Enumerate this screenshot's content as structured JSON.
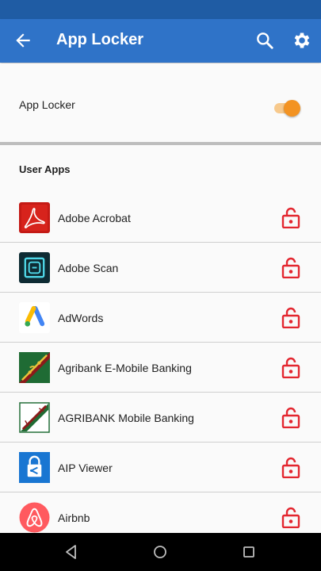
{
  "app_bar": {
    "title": "App Locker",
    "icons": [
      "back-arrow-icon",
      "search-icon",
      "gear-icon"
    ],
    "background": "#2f73c8"
  },
  "master_toggle": {
    "label": "App Locker",
    "enabled": true,
    "accent": "#f39322"
  },
  "section": {
    "title": "User Apps"
  },
  "apps": [
    {
      "name": "Adobe Acrobat",
      "icon": "adobe-acrobat-icon",
      "locked": false
    },
    {
      "name": "Adobe Scan",
      "icon": "adobe-scan-icon",
      "locked": false
    },
    {
      "name": "AdWords",
      "icon": "adwords-icon",
      "locked": false
    },
    {
      "name": "Agribank E-Mobile Banking",
      "icon": "agribank-emobile-icon",
      "locked": false
    },
    {
      "name": "AGRIBANK Mobile Banking",
      "icon": "agribank-mobile-icon",
      "locked": false
    },
    {
      "name": "AIP Viewer",
      "icon": "aip-viewer-icon",
      "locked": false
    },
    {
      "name": "Airbnb",
      "icon": "airbnb-icon",
      "locked": false
    }
  ],
  "nav_bar": {
    "buttons": [
      "back-triangle-icon",
      "home-circle-icon",
      "recents-square-icon"
    ]
  },
  "colors": {
    "lock": "#e3262f",
    "status_bar": "#1f5ca4"
  }
}
